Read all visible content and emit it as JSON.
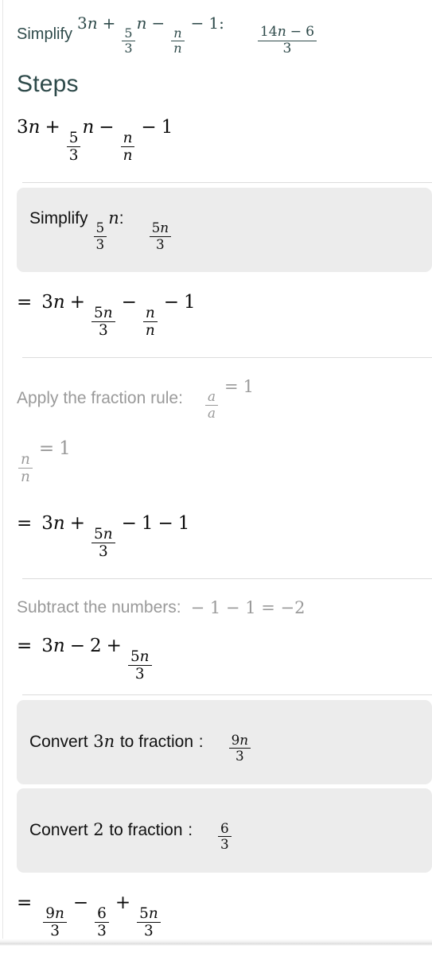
{
  "colors": {
    "heading_teal": "#2e4a4a",
    "body_black": "#0b0b0b",
    "muted_gray": "#9a9a9a",
    "box_gray": "#ececec",
    "divider": "#dcdcdc",
    "page_bg": "#ffffff"
  },
  "header": {
    "label": "Simplify",
    "expression_plain": "3n + 5/3 n − n/n − 1:",
    "expr": {
      "term1": "3",
      "term1_var": "n",
      "op1": "+",
      "frac1_num": "5",
      "frac1_den": "3",
      "frac1_var": "n",
      "op2": "−",
      "frac2_num": "n",
      "frac2_den": "n",
      "op3": "−",
      "term_last": "1",
      "colon": ":"
    },
    "result_plain": "(14n − 6)/3",
    "result": {
      "num_coef": "14",
      "num_var": "n",
      "num_op": "−",
      "num_const": "6",
      "den": "3"
    }
  },
  "steps_heading": "Steps",
  "steps": [
    {
      "id": "initial-expression",
      "kind": "equation",
      "muted": false,
      "plain": "3n + 5/3 n − n/n − 1",
      "parts": {
        "a": "3",
        "a_var": "n",
        "op1": "+",
        "f1n": "5",
        "f1d": "3",
        "f1_var": "n",
        "op2": "−",
        "f2n": "n",
        "f2d": "n",
        "op3": "−",
        "last": "1"
      }
    },
    {
      "id": "simplify-five-thirds-n",
      "kind": "grey-box",
      "label_text": "Simplify",
      "label_frac_num": "5",
      "label_frac_den": "3",
      "label_var": "n",
      "label_colon": ":",
      "value_num": "5",
      "value_num_var": "n",
      "value_den": "3",
      "plain": "Simplify 5/3 n:  5n/3"
    },
    {
      "id": "equation-after-simplify",
      "kind": "equation",
      "muted": false,
      "plain": "= 3n + 5n/3 − n/n − 1",
      "parts": {
        "eq": "=",
        "a": "3",
        "a_var": "n",
        "op1": "+",
        "f1n": "5",
        "f1n_var": "n",
        "f1d": "3",
        "op2": "−",
        "f2n": "n",
        "f2d": "n",
        "op3": "−",
        "last": "1"
      }
    },
    {
      "id": "fraction-rule",
      "kind": "rule-row",
      "label": "Apply the fraction rule:",
      "value_num": "a",
      "value_den": "a",
      "value_eq": "=",
      "value_res": "1",
      "plain": "Apply the fraction rule:  a/a = 1"
    },
    {
      "id": "n-over-n-equals-one",
      "kind": "equation",
      "muted": true,
      "plain": "n/n = 1",
      "parts": {
        "f2n": "n",
        "f2d": "n",
        "eq": "=",
        "res": "1"
      }
    },
    {
      "id": "equation-after-fraction-rule",
      "kind": "equation",
      "muted": false,
      "plain": "= 3n + 5n/3 − 1 − 1",
      "parts": {
        "eq": "=",
        "a": "3",
        "a_var": "n",
        "op1": "+",
        "f1n": "5",
        "f1n_var": "n",
        "f1d": "3",
        "op2": "−",
        "t1": "1",
        "op3": "−",
        "t2": "1"
      }
    },
    {
      "id": "subtract-the-numbers",
      "kind": "rule-row",
      "label": "Subtract the numbers:",
      "value_plain": "− 1 − 1 = −2",
      "plain": "Subtract the numbers:  − 1 − 1 = −2"
    },
    {
      "id": "equation-after-subtract",
      "kind": "equation",
      "muted": false,
      "plain": "= 3n − 2 + 5n/3",
      "parts": {
        "eq": "=",
        "a": "3",
        "a_var": "n",
        "op1": "−",
        "t1": "2",
        "op2": "+",
        "f1n": "5",
        "f1n_var": "n",
        "f1d": "3"
      }
    },
    {
      "id": "convert-3n-to-fraction",
      "kind": "grey-box",
      "label_text_a": "Convert",
      "label_coef": "3",
      "label_var": "n",
      "label_text_b": "to fraction",
      "label_colon": ":",
      "value_num": "9",
      "value_num_var": "n",
      "value_den": "3",
      "plain": "Convert 3n to fraction :  9n/3"
    },
    {
      "id": "convert-2-to-fraction",
      "kind": "grey-box",
      "label_text_a": "Convert",
      "label_coef": "2",
      "label_var": "",
      "label_text_b": "to fraction",
      "label_colon": ":",
      "value_num": "6",
      "value_num_var": "",
      "value_den": "3",
      "plain": "Convert 2 to fraction :  6/3"
    },
    {
      "id": "equation-common-denominator",
      "kind": "equation",
      "muted": false,
      "plain": "= 9n/3 − 6/3 + 5n/3",
      "parts": {
        "eq": "=",
        "f1n": "9",
        "f1n_var": "n",
        "f1d": "3",
        "op1": "−",
        "f2n": "6",
        "f2d": "3",
        "op2": "+",
        "f3n": "5",
        "f3n_var": "n",
        "f3d": "3"
      }
    }
  ]
}
